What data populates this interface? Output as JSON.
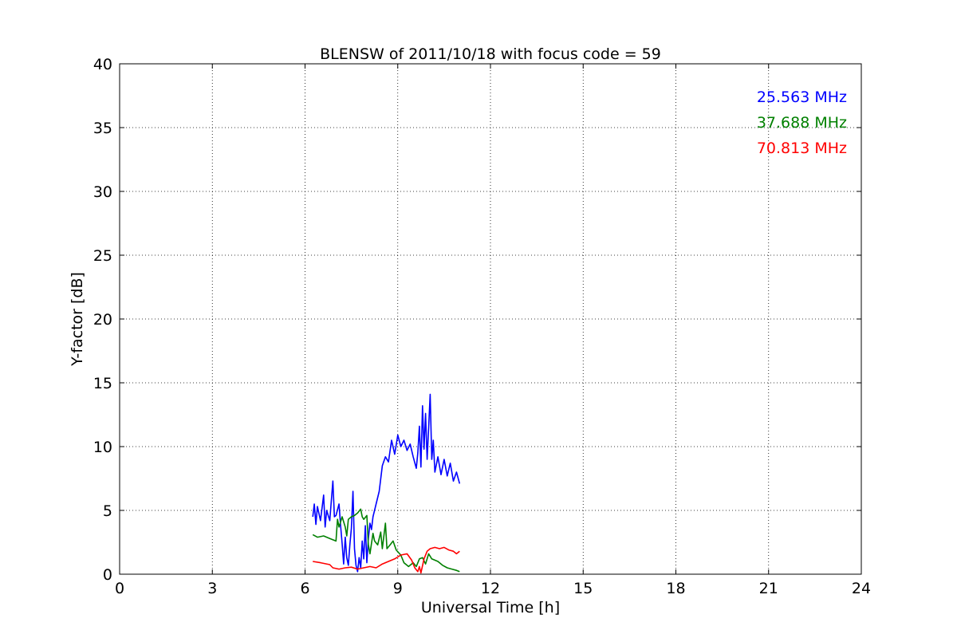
{
  "chart_data": {
    "type": "line",
    "title": "BLENSW of 2011/10/18 with focus code = 59",
    "xlabel": "Universal Time [h]",
    "ylabel": "Y-factor [dB]",
    "xlim": [
      0,
      24
    ],
    "ylim": [
      0,
      40
    ],
    "xticks": [
      0,
      3,
      6,
      9,
      12,
      15,
      18,
      21,
      24
    ],
    "yticks": [
      0,
      5,
      10,
      15,
      20,
      25,
      30,
      35,
      40
    ],
    "xtick_labels": [
      "0",
      "3",
      "6",
      "9",
      "12",
      "15",
      "18",
      "21",
      "24"
    ],
    "ytick_labels": [
      "0",
      "5",
      "10",
      "15",
      "20",
      "25",
      "30",
      "35",
      "40"
    ],
    "grid": true,
    "legend_placement": "top-right",
    "series": [
      {
        "name": "25.563 MHz",
        "color": "#0000ff",
        "points": [
          [
            6.25,
            4.5
          ],
          [
            6.3,
            5.5
          ],
          [
            6.35,
            3.9
          ],
          [
            6.4,
            5.3
          ],
          [
            6.5,
            4.2
          ],
          [
            6.6,
            6.2
          ],
          [
            6.65,
            3.7
          ],
          [
            6.7,
            5.0
          ],
          [
            6.8,
            4.2
          ],
          [
            6.9,
            7.3
          ],
          [
            6.95,
            4.5
          ],
          [
            7.0,
            4.6
          ],
          [
            7.1,
            5.5
          ],
          [
            7.15,
            3.8
          ],
          [
            7.2,
            2.4
          ],
          [
            7.25,
            0.8
          ],
          [
            7.3,
            2.9
          ],
          [
            7.35,
            1.3
          ],
          [
            7.4,
            0.7
          ],
          [
            7.45,
            2.3
          ],
          [
            7.5,
            3.6
          ],
          [
            7.55,
            6.5
          ],
          [
            7.6,
            2.0
          ],
          [
            7.65,
            0.7
          ],
          [
            7.7,
            0.2
          ],
          [
            7.75,
            1.3
          ],
          [
            7.8,
            0.5
          ],
          [
            7.85,
            2.6
          ],
          [
            7.9,
            1.2
          ],
          [
            7.95,
            3.8
          ],
          [
            8.0,
            0.9
          ],
          [
            8.05,
            2.8
          ],
          [
            8.1,
            4.0
          ],
          [
            8.15,
            3.5
          ],
          [
            8.2,
            4.5
          ],
          [
            8.3,
            5.5
          ],
          [
            8.4,
            6.5
          ],
          [
            8.5,
            8.5
          ],
          [
            8.6,
            9.2
          ],
          [
            8.7,
            8.8
          ],
          [
            8.8,
            10.5
          ],
          [
            8.9,
            9.4
          ],
          [
            9.0,
            10.9
          ],
          [
            9.1,
            10.0
          ],
          [
            9.2,
            10.5
          ],
          [
            9.3,
            9.7
          ],
          [
            9.4,
            10.2
          ],
          [
            9.5,
            9.2
          ],
          [
            9.6,
            8.3
          ],
          [
            9.65,
            9.5
          ],
          [
            9.7,
            11.6
          ],
          [
            9.75,
            8.4
          ],
          [
            9.8,
            13.2
          ],
          [
            9.85,
            9.8
          ],
          [
            9.9,
            12.6
          ],
          [
            9.95,
            9.0
          ],
          [
            10.0,
            11.5
          ],
          [
            10.05,
            14.1
          ],
          [
            10.1,
            9.0
          ],
          [
            10.15,
            10.5
          ],
          [
            10.2,
            8.0
          ],
          [
            10.3,
            9.2
          ],
          [
            10.4,
            7.8
          ],
          [
            10.5,
            9.0
          ],
          [
            10.6,
            7.7
          ],
          [
            10.7,
            8.7
          ],
          [
            10.8,
            7.3
          ],
          [
            10.9,
            8.0
          ],
          [
            11.0,
            7.1
          ]
        ]
      },
      {
        "name": "37.688 MHz",
        "color": "#008000",
        "points": [
          [
            6.25,
            3.1
          ],
          [
            6.4,
            2.9
          ],
          [
            6.6,
            3.0
          ],
          [
            6.8,
            2.8
          ],
          [
            7.0,
            2.6
          ],
          [
            7.05,
            4.3
          ],
          [
            7.1,
            3.7
          ],
          [
            7.2,
            4.5
          ],
          [
            7.3,
            3.7
          ],
          [
            7.35,
            3.0
          ],
          [
            7.4,
            4.3
          ],
          [
            7.5,
            4.5
          ],
          [
            7.6,
            4.6
          ],
          [
            7.7,
            4.8
          ],
          [
            7.8,
            5.1
          ],
          [
            7.85,
            4.5
          ],
          [
            7.9,
            4.3
          ],
          [
            8.0,
            4.6
          ],
          [
            8.05,
            2.3
          ],
          [
            8.1,
            1.6
          ],
          [
            8.2,
            3.2
          ],
          [
            8.25,
            2.6
          ],
          [
            8.35,
            2.3
          ],
          [
            8.45,
            3.3
          ],
          [
            8.5,
            2.0
          ],
          [
            8.6,
            4.0
          ],
          [
            8.65,
            2.0
          ],
          [
            8.75,
            2.3
          ],
          [
            8.85,
            2.6
          ],
          [
            8.95,
            1.9
          ],
          [
            9.1,
            1.5
          ],
          [
            9.2,
            0.9
          ],
          [
            9.35,
            0.6
          ],
          [
            9.5,
            0.9
          ],
          [
            9.6,
            0.6
          ],
          [
            9.7,
            1.2
          ],
          [
            9.8,
            1.3
          ],
          [
            9.9,
            0.8
          ],
          [
            10.0,
            1.6
          ],
          [
            10.1,
            1.2
          ],
          [
            10.2,
            1.1
          ],
          [
            10.3,
            1.0
          ],
          [
            10.45,
            0.7
          ],
          [
            10.6,
            0.5
          ],
          [
            10.75,
            0.4
          ],
          [
            10.9,
            0.3
          ],
          [
            11.0,
            0.2
          ]
        ]
      },
      {
        "name": "70.813 MHz",
        "color": "#ff0000",
        "points": [
          [
            6.25,
            1.0
          ],
          [
            6.5,
            0.9
          ],
          [
            6.8,
            0.75
          ],
          [
            6.9,
            0.5
          ],
          [
            7.1,
            0.4
          ],
          [
            7.3,
            0.5
          ],
          [
            7.5,
            0.55
          ],
          [
            7.7,
            0.4
          ],
          [
            7.9,
            0.5
          ],
          [
            8.1,
            0.6
          ],
          [
            8.3,
            0.5
          ],
          [
            8.5,
            0.8
          ],
          [
            8.7,
            1.0
          ],
          [
            8.9,
            1.2
          ],
          [
            9.1,
            1.5
          ],
          [
            9.3,
            1.6
          ],
          [
            9.45,
            1.1
          ],
          [
            9.55,
            0.5
          ],
          [
            9.65,
            0.2
          ],
          [
            9.7,
            0.6
          ],
          [
            9.75,
            0.1
          ],
          [
            9.85,
            1.2
          ],
          [
            9.95,
            1.8
          ],
          [
            10.05,
            2.0
          ],
          [
            10.2,
            2.1
          ],
          [
            10.35,
            2.0
          ],
          [
            10.5,
            2.1
          ],
          [
            10.65,
            1.9
          ],
          [
            10.8,
            1.8
          ],
          [
            10.9,
            1.6
          ],
          [
            11.0,
            1.8
          ]
        ]
      }
    ]
  }
}
